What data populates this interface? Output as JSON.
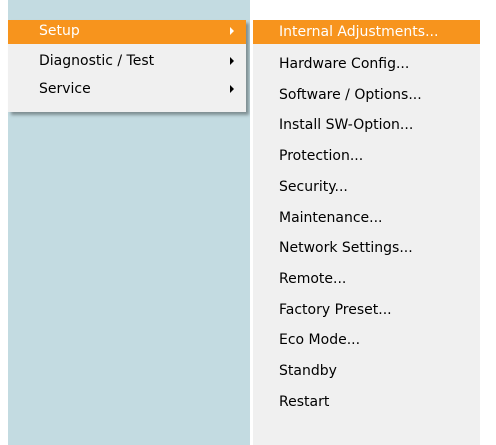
{
  "colors": {
    "accent": "#f7941d",
    "menu_bg": "#f0f0f0",
    "desktop_bg": "#c3dbe1"
  },
  "main_menu": {
    "items": [
      {
        "label": "Setup",
        "has_submenu": true,
        "active": true
      },
      {
        "label": "Diagnostic / Test",
        "has_submenu": true,
        "active": false
      },
      {
        "label": "Service",
        "has_submenu": true,
        "active": false
      }
    ]
  },
  "sub_menu": {
    "items": [
      {
        "label": "Internal Adjustments...",
        "active": true
      },
      {
        "label": "Hardware Config..."
      },
      {
        "label": "Software / Options..."
      },
      {
        "label": "Install SW-Option..."
      },
      {
        "label": "Protection..."
      },
      {
        "label": "Security..."
      },
      {
        "label": "Maintenance..."
      },
      {
        "label": "Network Settings..."
      },
      {
        "label": "Remote..."
      },
      {
        "label": "Factory Preset..."
      },
      {
        "label": "Eco Mode..."
      },
      {
        "label": "Standby"
      },
      {
        "label": "Restart"
      }
    ]
  }
}
